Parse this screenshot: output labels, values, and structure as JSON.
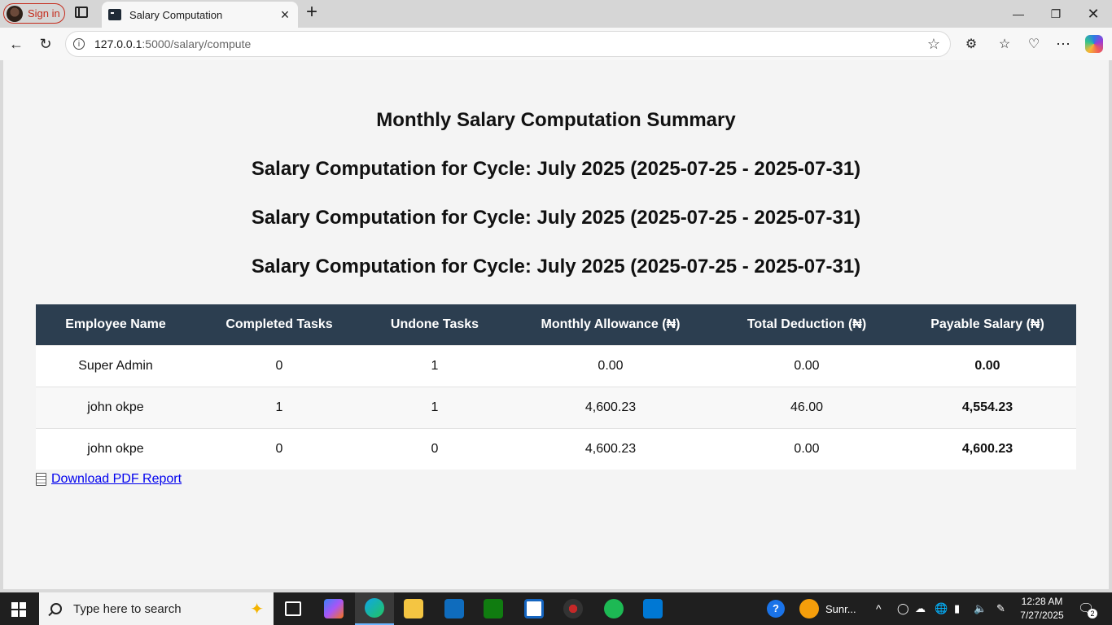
{
  "browser": {
    "profile_label": "Sign in",
    "tab_title": "Salary Computation",
    "url_host": "127.0.0.1",
    "url_rest": ":5000/salary/compute"
  },
  "page": {
    "heading": "Monthly Salary Computation Summary",
    "cycle_headings": [
      "Salary Computation for Cycle: July 2025 (2025-07-25 - 2025-07-31)",
      "Salary Computation for Cycle: July 2025 (2025-07-25 - 2025-07-31)",
      "Salary Computation for Cycle: July 2025 (2025-07-25 - 2025-07-31)"
    ],
    "table": {
      "headers": [
        "Employee Name",
        "Completed Tasks",
        "Undone Tasks",
        "Monthly Allowance (₦)",
        "Total Deduction (₦)",
        "Payable Salary (₦)"
      ],
      "rows": [
        [
          "Super Admin",
          "0",
          "1",
          "0.00",
          "0.00",
          "0.00"
        ],
        [
          "john okpe",
          "1",
          "1",
          "4,600.23",
          "46.00",
          "4,554.23"
        ],
        [
          "john okpe",
          "0",
          "0",
          "4,600.23",
          "0.00",
          "4,600.23"
        ]
      ]
    },
    "download_link": "Download PDF Report"
  },
  "taskbar": {
    "search_placeholder": "Type here to search",
    "weather_label": "Sunr...",
    "time": "12:28 AM",
    "date": "7/27/2025",
    "notification_count": "2"
  },
  "colors": {
    "table_header_bg": "#2c3e50",
    "profile_accent": "#c42b1c",
    "link": "#0000ee"
  }
}
